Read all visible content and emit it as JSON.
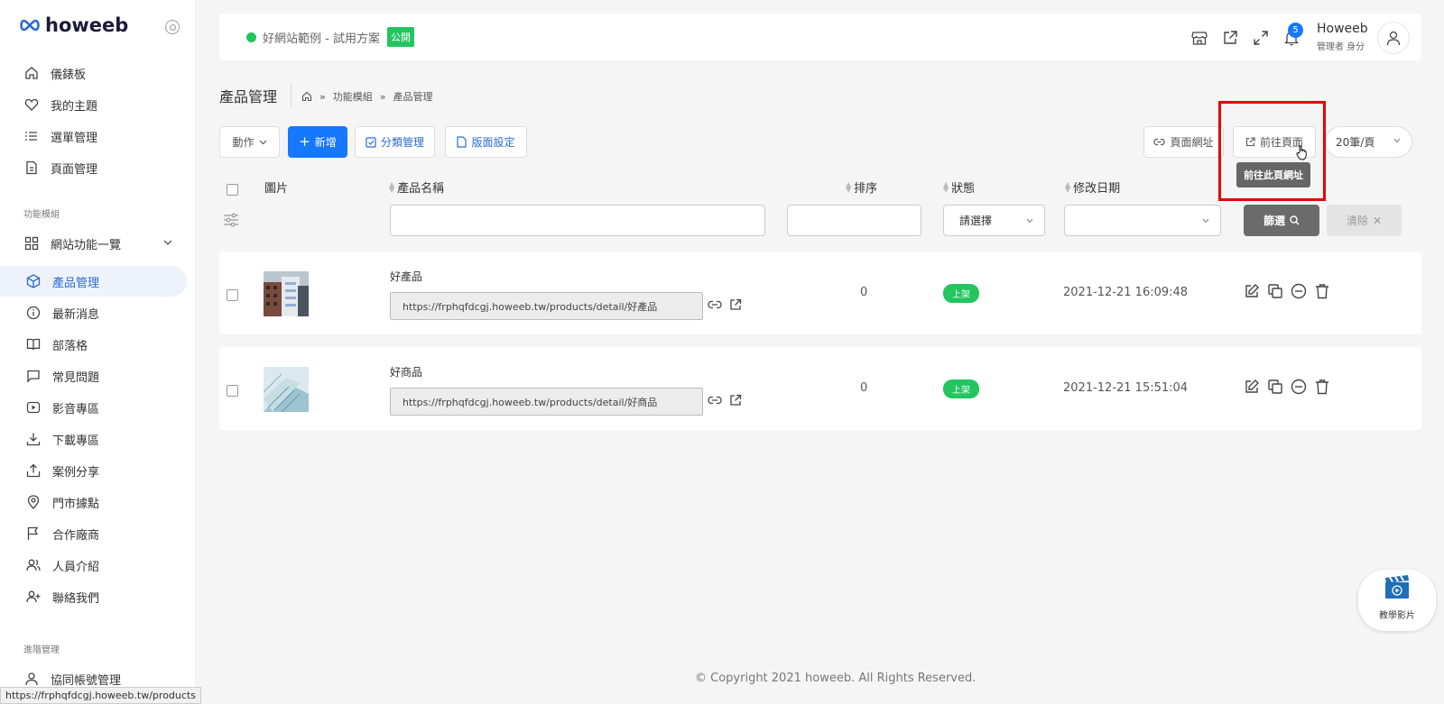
{
  "logo": {
    "text": "howeeb"
  },
  "sidebar": {
    "items": [
      {
        "label": "儀錶板",
        "icon": "home-icon"
      },
      {
        "label": "我的主題",
        "icon": "heart-icon"
      },
      {
        "label": "選單管理",
        "icon": "list-icon"
      },
      {
        "label": "頁面管理",
        "icon": "document-icon"
      }
    ],
    "section_modules": "功能模組",
    "overview": {
      "label": "網站功能一覽",
      "icon": "grid-icon"
    },
    "modules": [
      {
        "label": "產品管理",
        "icon": "cube-icon",
        "active": true
      },
      {
        "label": "最新消息",
        "icon": "info-icon"
      },
      {
        "label": "部落格",
        "icon": "book-icon"
      },
      {
        "label": "常見問題",
        "icon": "chat-icon"
      },
      {
        "label": "影音專區",
        "icon": "play-icon"
      },
      {
        "label": "下載專區",
        "icon": "download-icon"
      },
      {
        "label": "案例分享",
        "icon": "share-icon"
      },
      {
        "label": "門市據點",
        "icon": "location-icon"
      },
      {
        "label": "合作廠商",
        "icon": "flag-icon"
      },
      {
        "label": "人員介紹",
        "icon": "users-icon"
      },
      {
        "label": "聯絡我們",
        "icon": "user-plus-icon"
      }
    ],
    "section_advanced": "進階管理",
    "advanced": [
      {
        "label": "協同帳號管理",
        "icon": "user-icon"
      }
    ]
  },
  "header": {
    "site_name": "好網站範例 - 試用方案",
    "public_badge": "公開",
    "notification_count": "5",
    "user_name": "Howeeb",
    "user_role": "管理者 身分"
  },
  "page": {
    "title": "產品管理",
    "breadcrumb": [
      "功能模組",
      "產品管理"
    ]
  },
  "toolbar": {
    "action_label": "動作",
    "add_label": "新增",
    "category_label": "分類管理",
    "layout_label": "版面設定",
    "page_url_label": "頁面網址",
    "goto_page_label": "前往頁面",
    "per_page": "20筆/頁",
    "tooltip": "前往此頁網址"
  },
  "table": {
    "headers": {
      "image": "圖片",
      "name": "產品名稱",
      "order": "排序",
      "status": "狀態",
      "modified": "修改日期"
    },
    "filter": {
      "status_placeholder": "請選擇",
      "filter_label": "篩選",
      "clear_label": "清除"
    },
    "rows": [
      {
        "name": "好產品",
        "url": "https://frphqfdcgj.howeeb.tw/products/detail/好產品",
        "order": "0",
        "status": "上架",
        "modified": "2021-12-21 16:09:48"
      },
      {
        "name": "好商品",
        "url": "https://frphqfdcgj.howeeb.tw/products/detail/好商品",
        "order": "0",
        "status": "上架",
        "modified": "2021-12-21 15:51:04"
      }
    ]
  },
  "footer": {
    "copyright": "© Copyright 2021 howeeb. All Rights Reserved."
  },
  "status_bar": {
    "url": "https://frphqfdcgj.howeeb.tw/products"
  },
  "tutorial": {
    "label": "教學影片"
  },
  "colors": {
    "primary": "#1677ff",
    "success": "#22c55e",
    "highlight": "#e60000"
  }
}
